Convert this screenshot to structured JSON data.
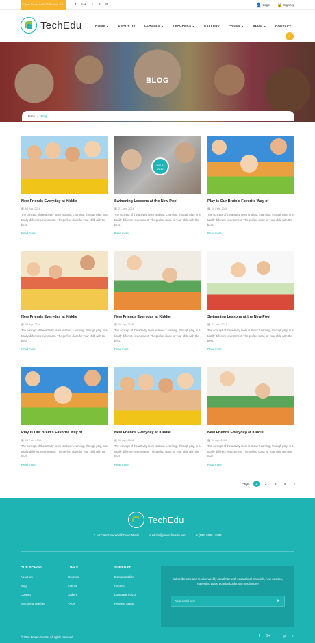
{
  "topbar": {
    "hours": "Open hours: 8:00-16:00 Mon-Sat",
    "social": [
      "f",
      "G+",
      "t",
      "p",
      "in"
    ],
    "login": "Login",
    "signup": "Sign Up"
  },
  "brand": {
    "name": "TechEdu"
  },
  "nav": [
    "HOME ⌄",
    "ABOUT US",
    "CLASSES ⌄",
    "TEACHERS ⌄",
    "GALLERY",
    "PAGES ⌄",
    "BLOG ⌄",
    "CONTACT"
  ],
  "hero": {
    "title": "BLOG"
  },
  "breadcrumb": {
    "home": "Home",
    "sep": "»",
    "current": "Blog"
  },
  "badge": {
    "day": "JAN 24",
    "year": "2016"
  },
  "posts": [
    {
      "title": "New Friends Everyday at Kiddie",
      "date": "09 Apr, 2016"
    },
    {
      "title": "Swimming Lessons at the New Pool",
      "date": "27 Jan, 2016"
    },
    {
      "title": "Play is Our Brain's Favorite Way of",
      "date": "10 Feb, 2016"
    },
    {
      "title": "New Friends Everyday at Kiddie",
      "date": "08 Apr, 2016"
    },
    {
      "title": "New Friends Everyday at Kiddie",
      "date": "08 Apr, 2016"
    },
    {
      "title": "Swimming Lessons at the New Pool",
      "date": "27 Jan, 2016"
    },
    {
      "title": "Play is Our Brain's Favorite Way of",
      "date": "10 Feb, 2016"
    },
    {
      "title": "New Friends Everyday at Kiddie",
      "date": "08 Apr, 2016"
    },
    {
      "title": "New Friends Everyday at Kiddie",
      "date": "09 Apr, 2016"
    }
  ],
  "post_excerpt": "The concept of the activity room is about 'Learning', through play, in a totally different environment. The perfect class for your child with the best.",
  "read_more": "Read more",
  "pagination": {
    "label": "Page:",
    "pages": [
      "1",
      "2",
      "3",
      "4"
    ],
    "next": "›"
  },
  "footer": {
    "address": "1st Floor New World Tower Miami",
    "email": "admin@power-boosts.com",
    "phone": "(800) 2345 - 6789",
    "school": {
      "title": "OUR SCHOOL",
      "items": [
        "About Us",
        "Blog",
        "Contact",
        "Become a Teacher"
      ]
    },
    "links": {
      "title": "LINKS",
      "items": [
        "Courses",
        "Events",
        "Gallery",
        "FAQs"
      ]
    },
    "support": {
      "title": "SUPPORT",
      "items": [
        "Documentation",
        "Forums",
        "Language Packs",
        "Release Status"
      ]
    },
    "newsletter": {
      "text": "Subscribe now and receive weekly newsletter with educational materials, new courses, interesting posts, popular books and much more!",
      "placeholder": "Your email here"
    },
    "copyright": "© 2016 Power-Boosts. All rights reserved",
    "social": [
      "f",
      "G+",
      "t",
      "p",
      "in"
    ]
  },
  "colors": {
    "accent": "#1fb4b4",
    "yellow": "#f7b32b"
  }
}
